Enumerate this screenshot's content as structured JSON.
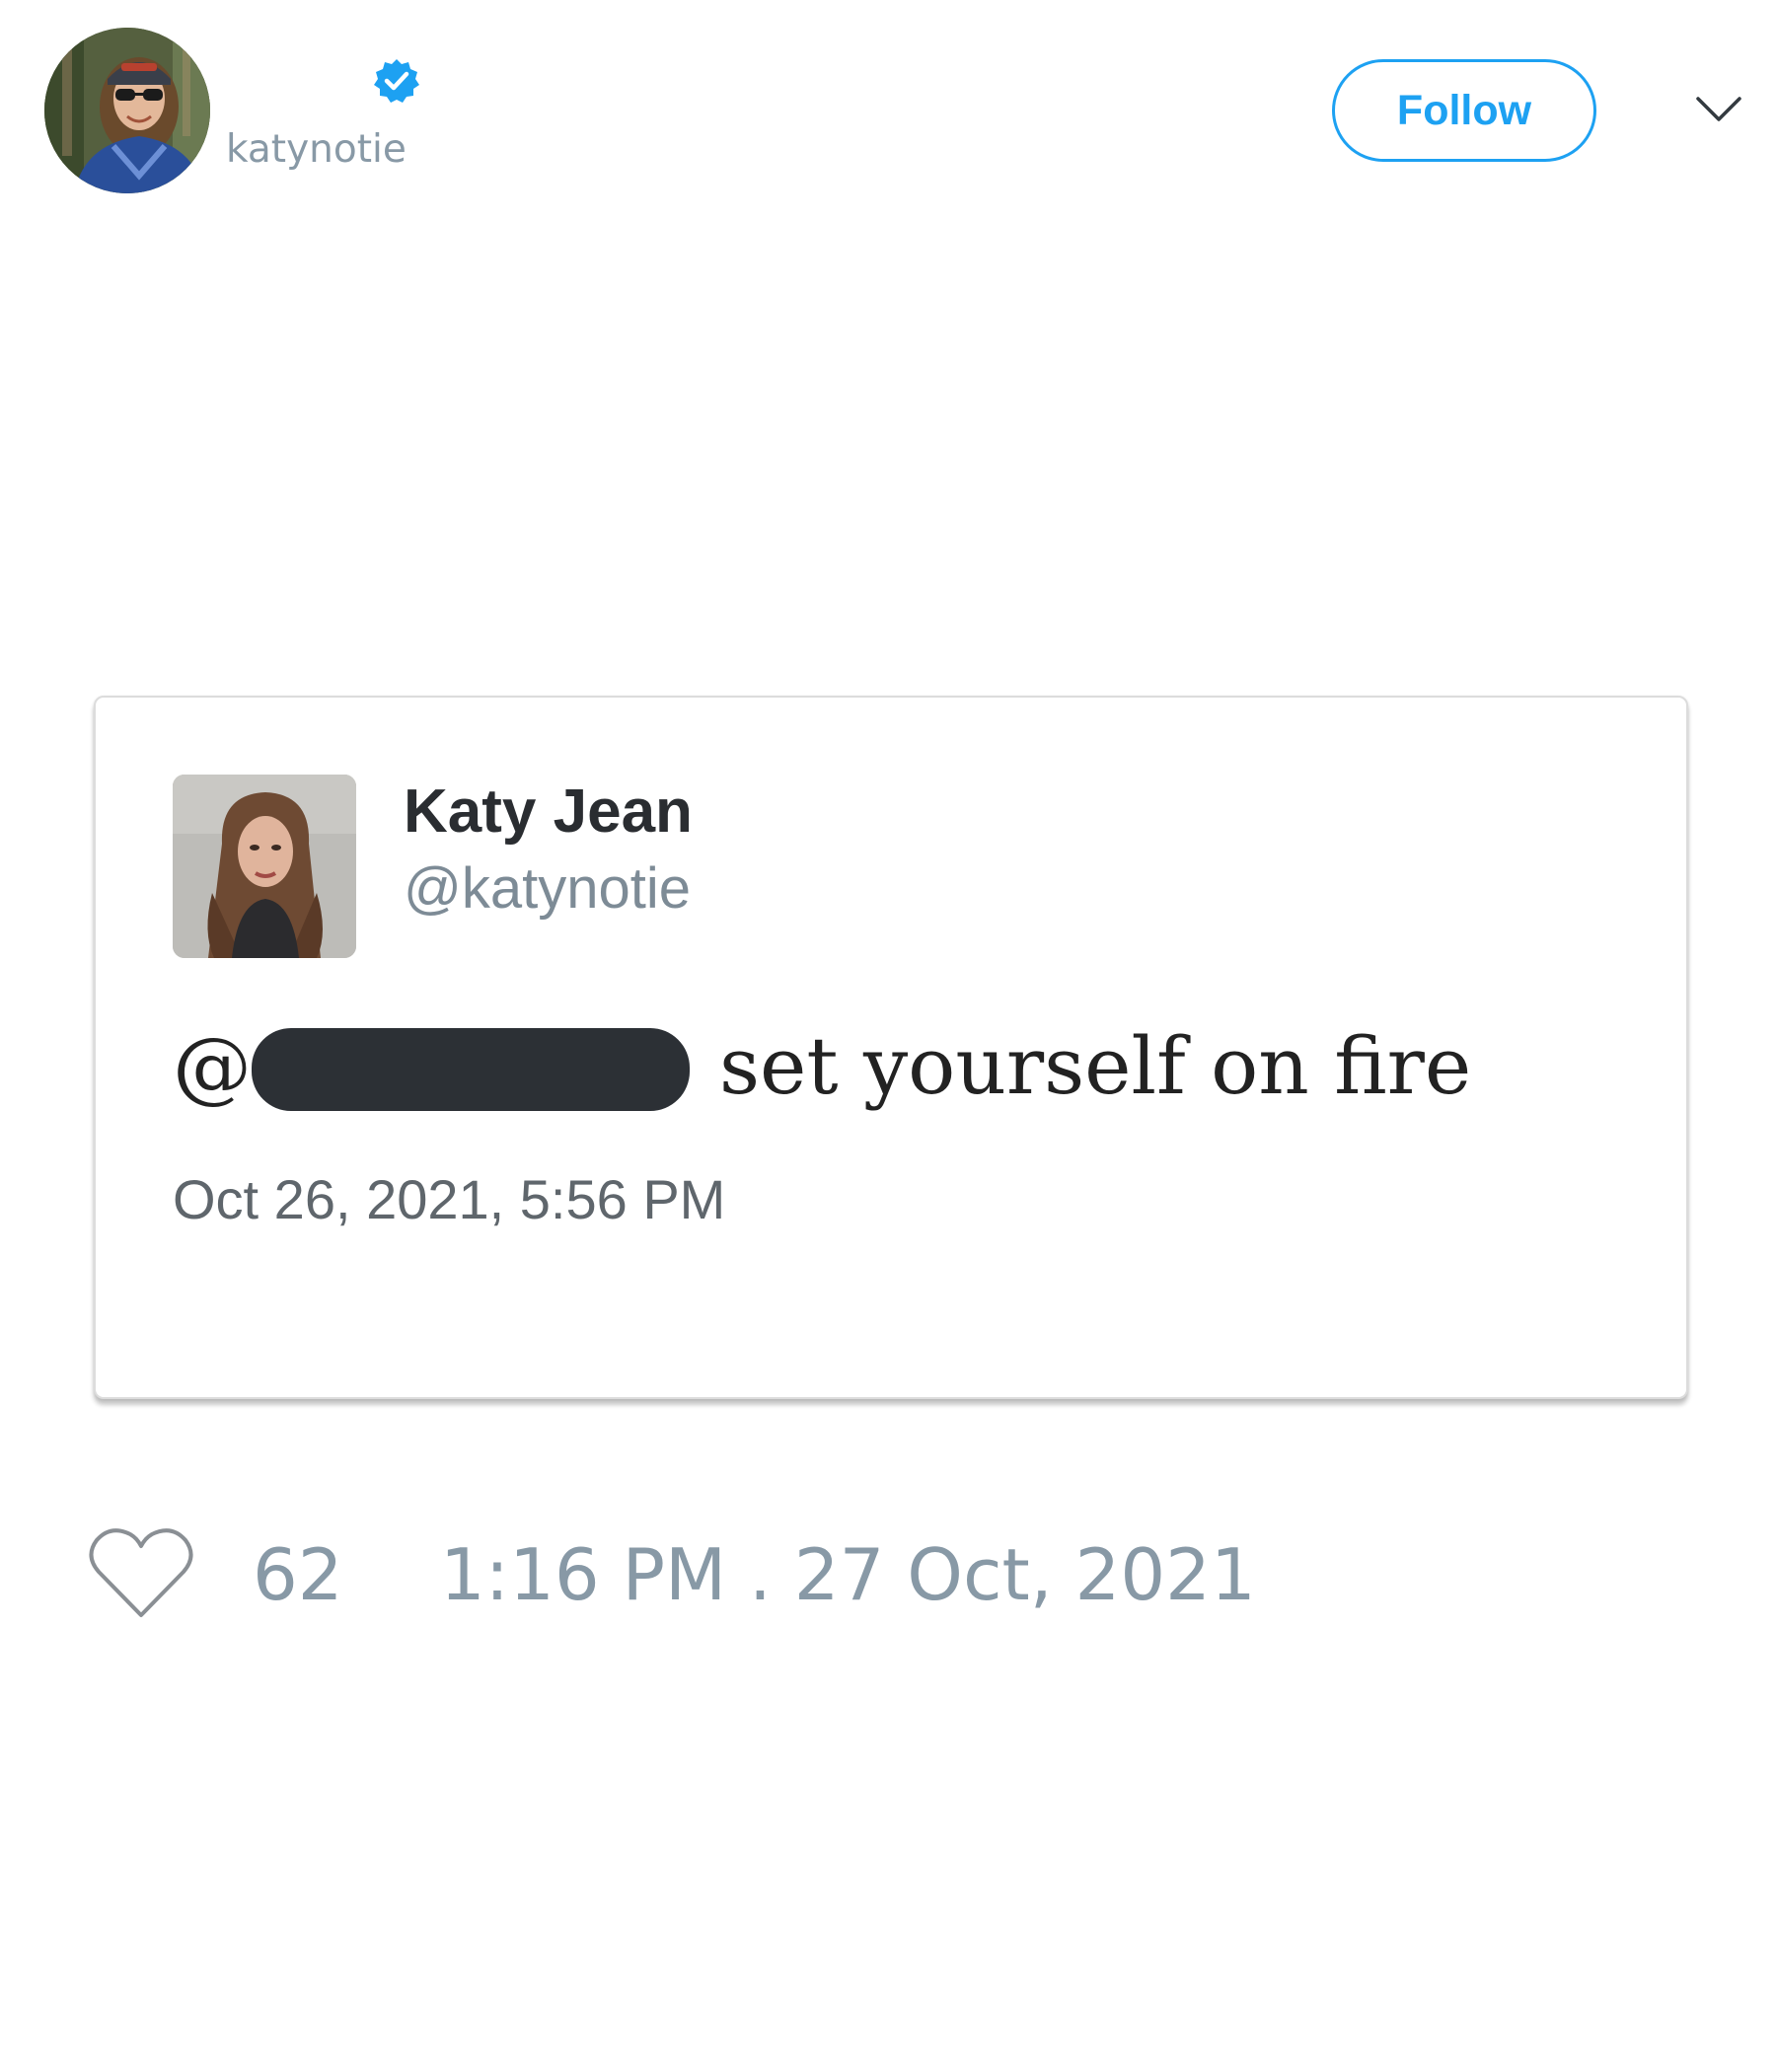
{
  "header": {
    "handle": "katynotie",
    "follow_label": "Follow",
    "verified": true
  },
  "quoted_card": {
    "display_name": "Katy Jean",
    "handle": "@katynotie",
    "text_prefix": "@",
    "text_body": "set yourself on fire",
    "timestamp": "Oct 26, 2021, 5:56 PM"
  },
  "footer": {
    "like_count": "62",
    "time": "1:16 PM . 27 Oct, 2021"
  },
  "colors": {
    "accent": "#1da1f2",
    "muted": "#8899a6",
    "text_dark": "#2a2d31",
    "redaction": "#2c3035"
  },
  "icons": {
    "verified": "verified-badge-icon",
    "more": "chevron-down-icon",
    "like": "heart-icon"
  }
}
